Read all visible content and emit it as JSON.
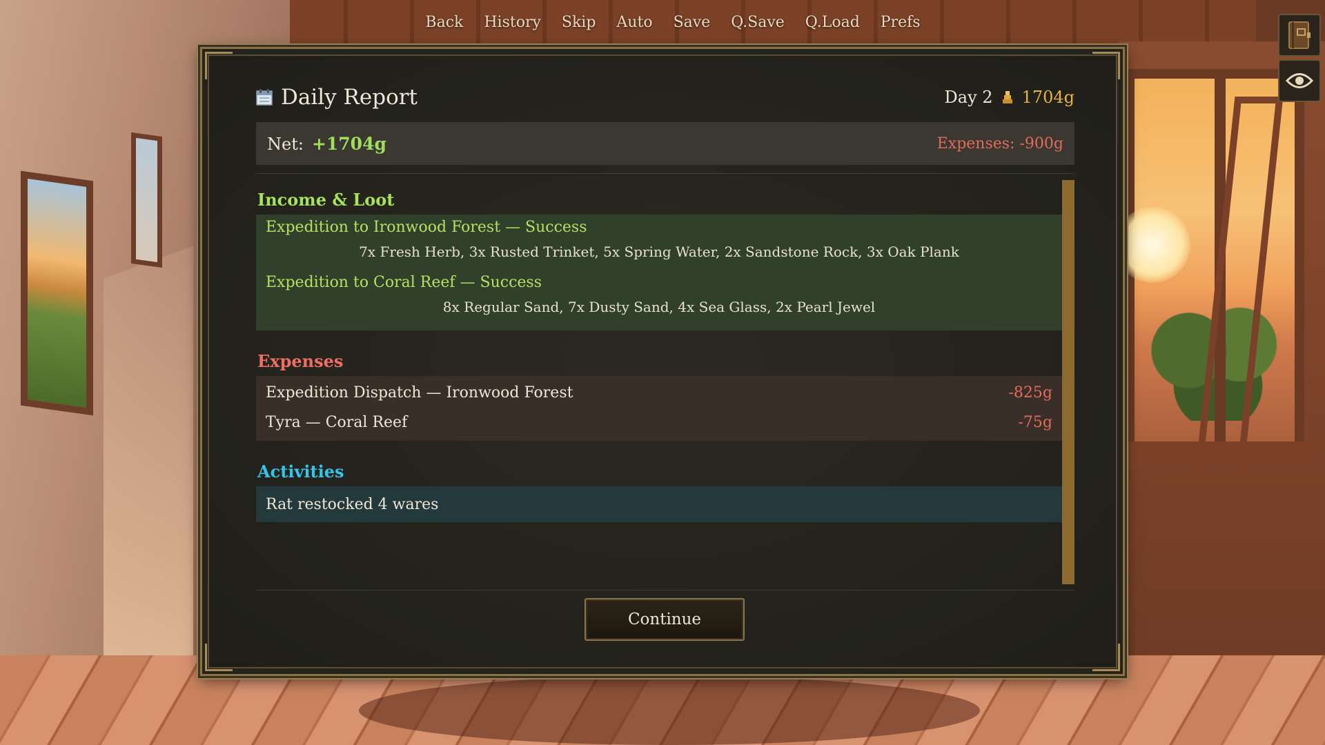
{
  "quick_menu": [
    "Back",
    "History",
    "Skip",
    "Auto",
    "Save",
    "Q.Save",
    "Q.Load",
    "Prefs"
  ],
  "side_buttons": [
    {
      "icon": "journal-icon"
    },
    {
      "icon": "eye-icon"
    }
  ],
  "report": {
    "title": "Daily Report",
    "title_icon": "calendar-icon",
    "day": "Day 2",
    "gold_icon": "coin-stack-icon",
    "gold": "1704g",
    "net_label": "Net:",
    "net_value": "+1704g",
    "expenses_total": "Expenses: -900g"
  },
  "income": {
    "title": "Income & Loot",
    "expeditions": [
      {
        "line": "Expedition to Ironwood Forest — Success",
        "loot": "7x Fresh Herb, 3x Rusted Trinket, 5x Spring Water, 2x Sandstone Rock, 3x Oak Plank"
      },
      {
        "line": "Expedition to Coral Reef — Success",
        "loot": "8x Regular Sand, 7x Dusty Sand, 4x Sea Glass, 2x Pearl Jewel"
      }
    ]
  },
  "expenses": {
    "title": "Expenses",
    "items": [
      {
        "name": "Expedition Dispatch — Ironwood Forest",
        "amount": "-825g"
      },
      {
        "name": "Tyra — Coral Reef",
        "amount": "-75g"
      }
    ]
  },
  "activities": {
    "title": "Activities",
    "items": [
      "Rat restocked 4 wares"
    ]
  },
  "continue_label": "Continue",
  "colors": {
    "income": "#a6e25c",
    "expenses": "#ef6f64",
    "activities": "#33c6ea",
    "gold": "#e8b43e",
    "panel_border": "#8a7446"
  }
}
